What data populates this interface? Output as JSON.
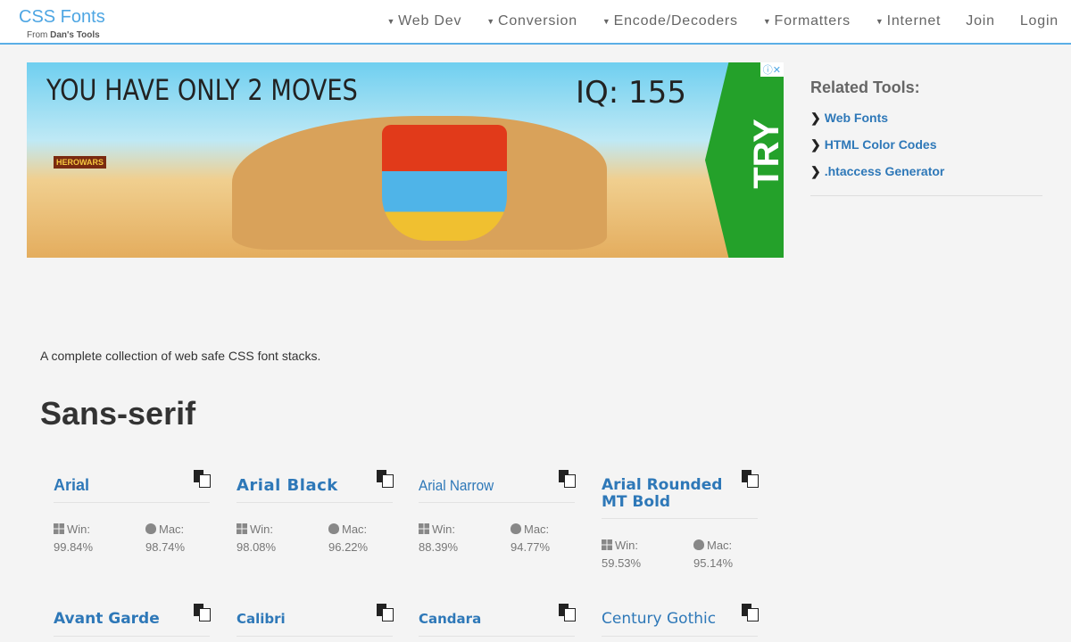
{
  "header": {
    "brand": "CSS Fonts",
    "subtitle_prefix": "From",
    "subtitle_brand": "Dan's Tools",
    "menu": [
      {
        "label": "Web Dev",
        "dropdown": true
      },
      {
        "label": "Conversion",
        "dropdown": true
      },
      {
        "label": "Encode/Decoders",
        "dropdown": true
      },
      {
        "label": "Formatters",
        "dropdown": true
      },
      {
        "label": "Internet",
        "dropdown": true
      },
      {
        "label": "Join",
        "dropdown": false
      },
      {
        "label": "Login",
        "dropdown": false
      }
    ]
  },
  "ad": {
    "headline": "YOU HAVE ONLY 2 MOVES",
    "iq": "IQ: 155",
    "cta": "TRY",
    "logo": "HEROWARS",
    "close": "ⓘ✕"
  },
  "sidebar": {
    "title": "Related Tools:",
    "links": [
      "Web Fonts",
      "HTML Color Codes",
      ".htaccess Generator"
    ]
  },
  "intro": "A complete collection of web safe CSS font stacks.",
  "section_title": "Sans-serif",
  "labels": {
    "win": "Win:",
    "mac": "Mac:"
  },
  "fonts": [
    {
      "name": "Arial",
      "win": "99.84%",
      "mac": "98.74%"
    },
    {
      "name": "Arial Black",
      "win": "98.08%",
      "mac": "96.22%"
    },
    {
      "name": "Arial Narrow",
      "win": "88.39%",
      "mac": "94.77%"
    },
    {
      "name": "Arial Rounded MT Bold",
      "win": "59.53%",
      "mac": "95.14%"
    },
    {
      "name": "Avant Garde"
    },
    {
      "name": "Calibri"
    },
    {
      "name": "Candara"
    },
    {
      "name": "Century Gothic"
    }
  ],
  "colors": {
    "accent": "#4ea6e3",
    "link": "#2e78b8",
    "background": "#f4f4f4"
  }
}
